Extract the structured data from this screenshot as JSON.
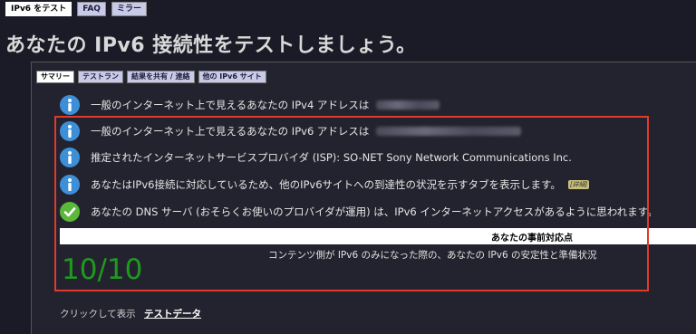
{
  "top_tabs": [
    "IPv6 をテスト",
    "FAQ",
    "ミラー"
  ],
  "page_title": "あなたの IPv6 接続性をテストしましょう。",
  "sub_tabs": [
    "サマリー",
    "テストラン",
    "結果を共有 / 連絡",
    "他の IPv6 サイト"
  ],
  "rows": [
    {
      "icon": "info-icon",
      "text": "一般のインターネット上で見えるあなたの IPv4 アドレスは"
    },
    {
      "icon": "info-icon",
      "text": "一般のインターネット上で見えるあなたの IPv6 アドレスは"
    },
    {
      "icon": "info-icon",
      "text": "推定されたインターネットサービスプロバイダ (ISP): SO-NET Sony Network Communications Inc."
    },
    {
      "icon": "info-icon",
      "text": "あなたはIPv6接続に対応しているため、他のIPv6サイトへの到達性の状況を示すタブを表示します。",
      "badge": "[詳細]"
    },
    {
      "icon": "check-icon",
      "text": "あなたの DNS サーバ (おそらくお使いのプロバイダが運用) は、IPv6 インターネットアクセスがあるように思われます。"
    }
  ],
  "readiness": {
    "header": "あなたの事前対応点",
    "score": "10/10",
    "description": "コンテンツ側が IPv6 のみになった際の、あなたの IPv6 の安定性と準備状況"
  },
  "footer": {
    "prefix": "クリックして表示",
    "link": "テストデータ"
  },
  "colors": {
    "background": "#1b1b27",
    "info": "#3d8fd8",
    "check": "#5bb83a",
    "score": "#1f9a1f",
    "highlight": "#e03a2a"
  }
}
